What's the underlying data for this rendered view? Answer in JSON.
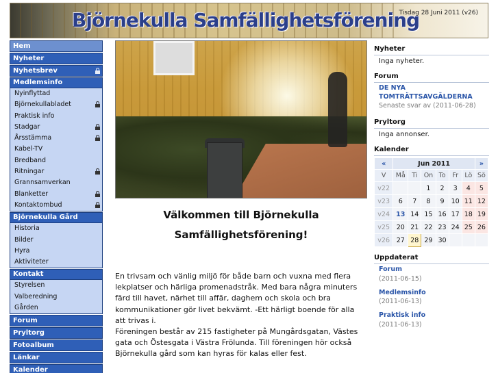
{
  "header": {
    "site_title": "Björnekulla Samfällighetsförening",
    "date": "Tisdag 28 Juni 2011  (v26)"
  },
  "nav": {
    "top1": [
      {
        "label": "Hem",
        "active": true,
        "locked": false
      },
      {
        "label": "Nyheter",
        "locked": false
      },
      {
        "label": "Nyhetsbrev",
        "locked": true
      }
    ],
    "medlemsinfo": {
      "label": "Medlemsinfo",
      "items": [
        {
          "label": "Nyinflyttad",
          "locked": false
        },
        {
          "label": "Björnekullabladet",
          "locked": true
        },
        {
          "label": "Praktisk info",
          "locked": false
        },
        {
          "label": "Stadgar",
          "locked": true
        },
        {
          "label": "Årsstämma",
          "locked": true
        },
        {
          "label": "Kabel-TV",
          "locked": false
        },
        {
          "label": "Bredband",
          "locked": false
        },
        {
          "label": "Ritningar",
          "locked": true
        },
        {
          "label": "Grannsamverkan",
          "locked": false
        },
        {
          "label": "Blanketter",
          "locked": true
        },
        {
          "label": "Kontaktombud",
          "locked": true
        }
      ]
    },
    "gard": {
      "label": "Björnekulla Gård",
      "items": [
        {
          "label": "Historia"
        },
        {
          "label": "Bilder"
        },
        {
          "label": "Hyra"
        },
        {
          "label": "Aktiviteter"
        }
      ]
    },
    "kontakt": {
      "label": "Kontakt",
      "items": [
        {
          "label": "Styrelsen"
        },
        {
          "label": "Valberedning"
        },
        {
          "label": "Gården"
        }
      ]
    },
    "bottom": [
      {
        "label": "Forum"
      },
      {
        "label": "Pryltorg"
      },
      {
        "label": "Fotoalbum"
      },
      {
        "label": "Länkar"
      },
      {
        "label": "Kalender"
      }
    ]
  },
  "main": {
    "welcome_line1": "Välkommen till Björnekulla",
    "welcome_line2": "Samfällighetsförening!",
    "intro_p1": "En trivsam och vänlig miljö för både barn och vuxna med flera lekplatser och härliga promenadstråk. Med bara några minuters färd till havet, närhet till affär, daghem och skola och bra kommunikationer gör livet bekvämt. -Ett härligt boende för alla att trivas i.",
    "intro_p2": "Föreningen består av 215 fastigheter på Mungårdsgatan, Västes gata och Östesgata i Västra Frölunda. Till föreningen hör också Björnekulla gård som kan hyras för kalas eller fest."
  },
  "side": {
    "nyheter": {
      "title": "Nyheter",
      "text": "Inga nyheter."
    },
    "forum": {
      "title": "Forum",
      "link": "DE NYA TOMTRÄTTSAVGÄLDERNA",
      "meta": "Senaste svar av (2011-06-28)"
    },
    "pryltorg": {
      "title": "Pryltorg",
      "text": "Inga annonser."
    },
    "kalender": {
      "title": "Kalender",
      "prev": "«",
      "next": "»",
      "month": "Jun 2011",
      "dow": [
        "V",
        "Må",
        "Ti",
        "On",
        "To",
        "Fr",
        "Lö",
        "Sö"
      ],
      "weeks": [
        {
          "wk": "v22",
          "days": [
            "",
            "",
            "1",
            "2",
            "3",
            "4",
            "5"
          ]
        },
        {
          "wk": "v23",
          "days": [
            "6",
            "7",
            "8",
            "9",
            "10",
            "11",
            "12"
          ]
        },
        {
          "wk": "v24",
          "days": [
            "13",
            "14",
            "15",
            "16",
            "17",
            "18",
            "19"
          ]
        },
        {
          "wk": "v25",
          "days": [
            "20",
            "21",
            "22",
            "23",
            "24",
            "25",
            "26"
          ]
        },
        {
          "wk": "v26",
          "days": [
            "27",
            "28",
            "29",
            "30",
            "",
            "",
            ""
          ]
        }
      ],
      "today": "13",
      "selected": "28"
    },
    "uppdaterat": {
      "title": "Uppdaterat",
      "items": [
        {
          "label": "Forum",
          "date": "(2011-06-15)"
        },
        {
          "label": "Medlemsinfo",
          "date": "(2011-06-13)"
        },
        {
          "label": "Praktisk info",
          "date": "(2011-06-13)"
        }
      ]
    }
  }
}
